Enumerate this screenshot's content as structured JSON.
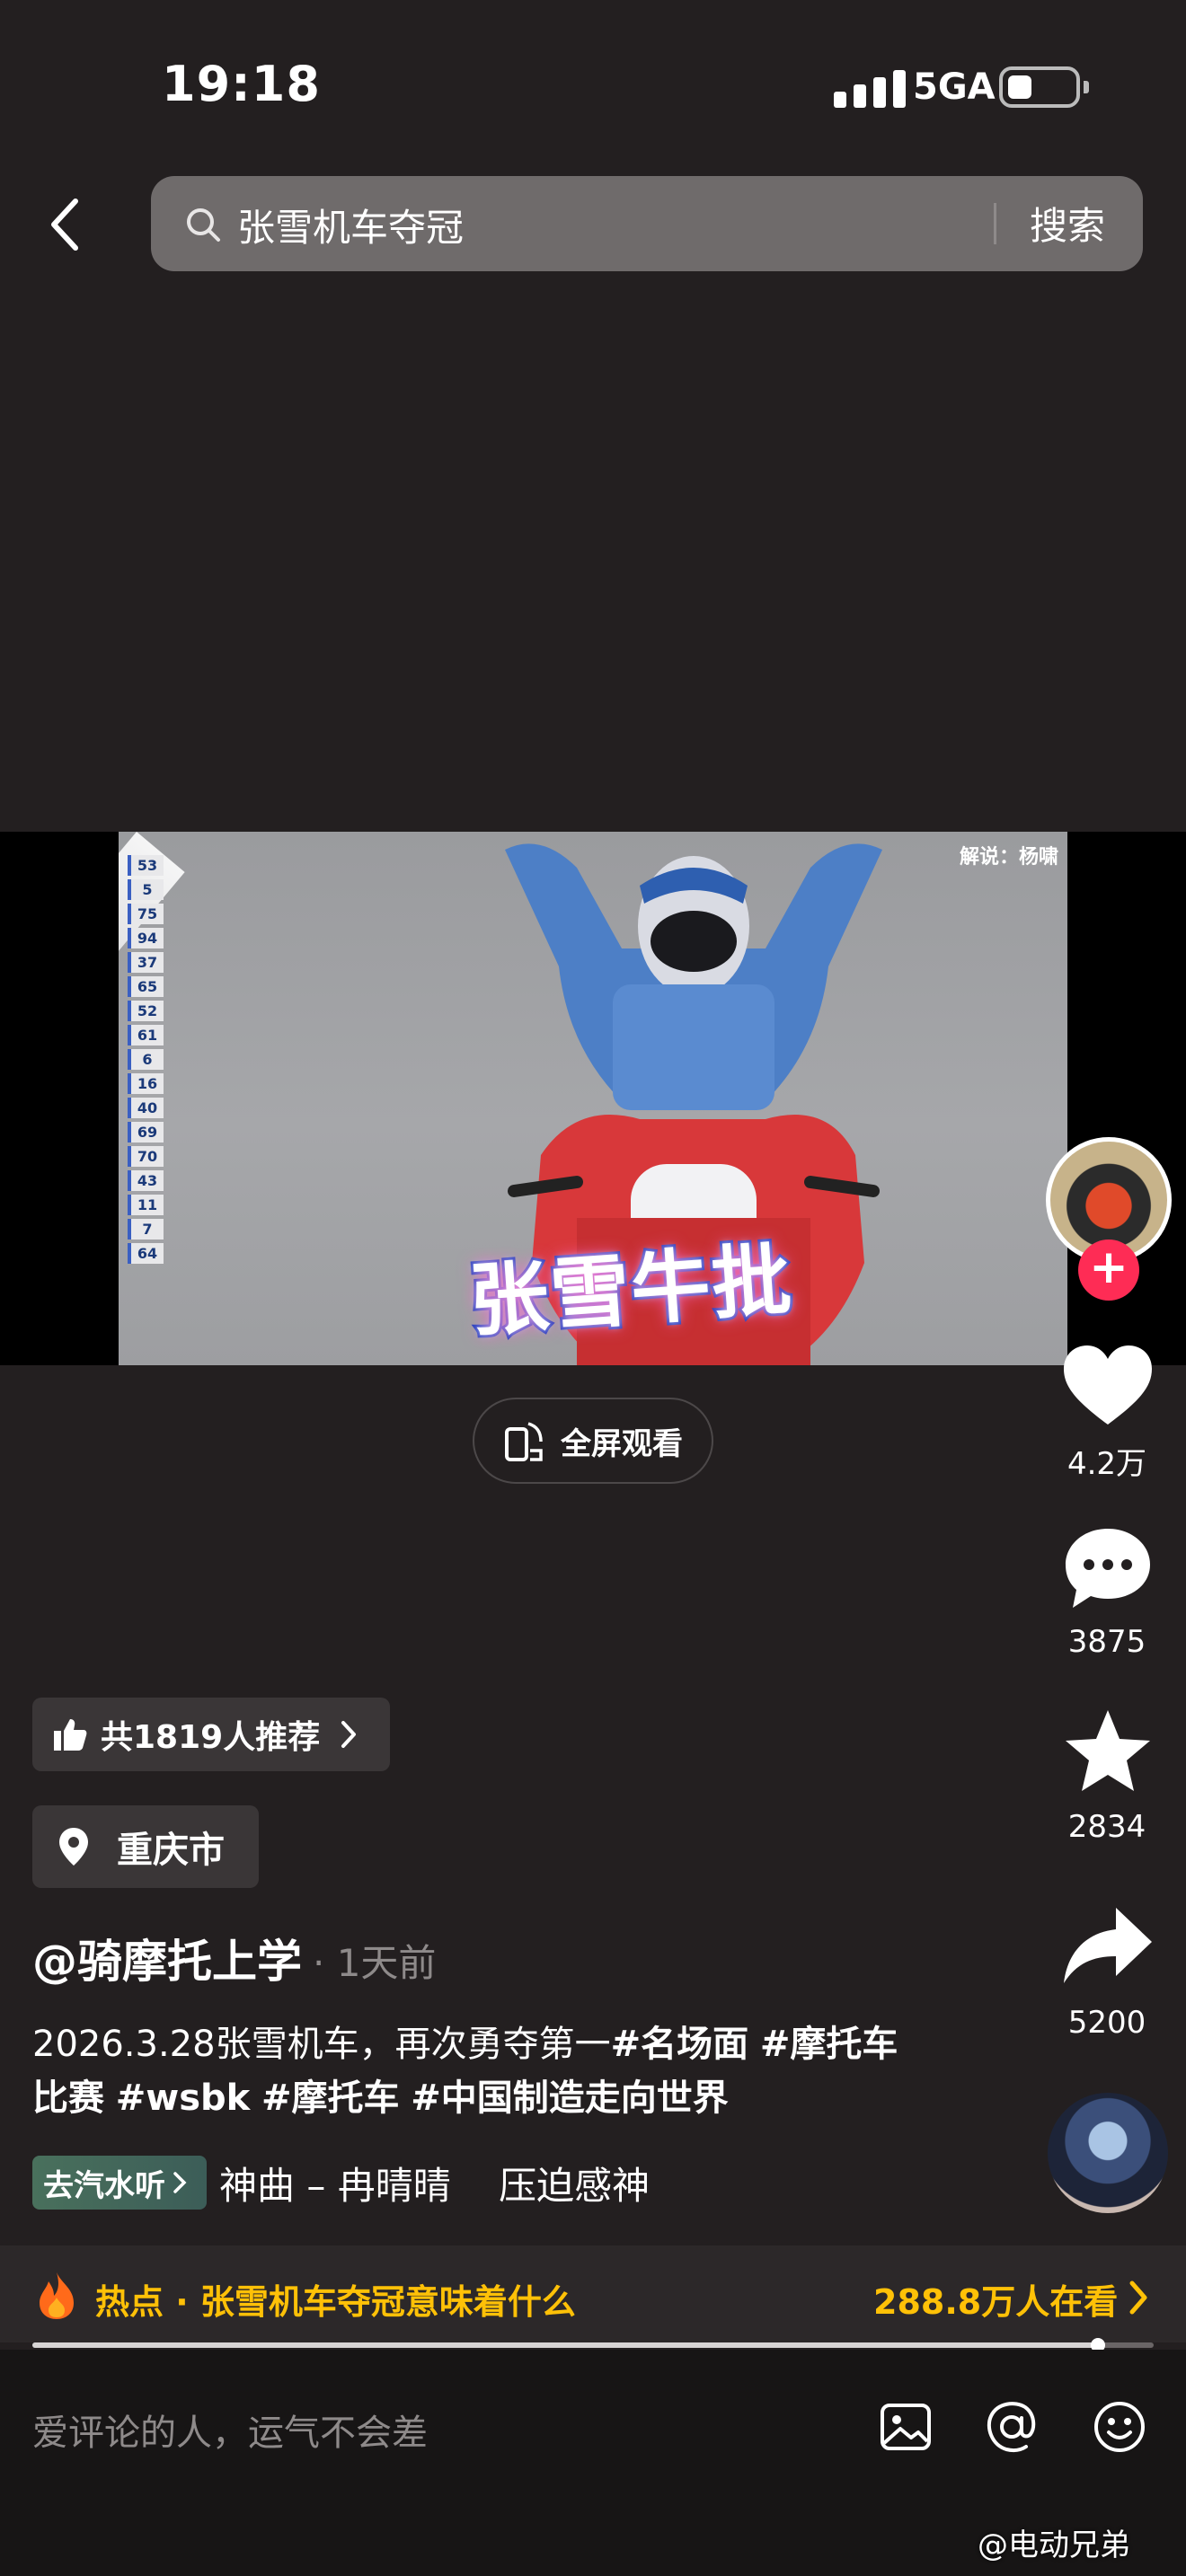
{
  "status_bar": {
    "time": "19:18",
    "network": "5GA",
    "icons": [
      "signal-icon",
      "battery-icon"
    ]
  },
  "header": {
    "back_icon": "chevron-left-icon",
    "search_icon": "search-icon",
    "search_query": "张雪机车夺冠",
    "search_button": "搜索"
  },
  "video": {
    "overlay_caption": "张雪牛批",
    "corner_caption": "解说：杨啸",
    "standings": [
      "53",
      "5",
      "75",
      "94",
      "37",
      "65",
      "52",
      "61",
      "6",
      "16",
      "40",
      "69",
      "70",
      "43",
      "11",
      "7",
      "64"
    ]
  },
  "fullscreen": {
    "icon": "rotate-screen-icon",
    "label": "全屏观看"
  },
  "right_rail": {
    "avatar": "creator-avatar",
    "follow_icon": "plus-icon",
    "like": {
      "icon": "heart-icon",
      "count": "4.2万"
    },
    "comment": {
      "icon": "comment-bubble-icon",
      "count": "3875"
    },
    "favorite": {
      "icon": "star-icon",
      "count": "2834"
    },
    "share": {
      "icon": "share-arrow-icon",
      "count": "5200"
    },
    "music_disc": "music-disc-icon"
  },
  "post": {
    "recommend": {
      "icon": "thumbs-up-icon",
      "label": "共1819人推荐",
      "chevron": "chevron-right-icon"
    },
    "location": {
      "icon": "location-pin-icon",
      "label": "重庆市"
    },
    "author": "@骑摩托上学",
    "time_ago": "· 1天前",
    "description_text": "2026.3.28张雪机车，再次勇夺第一",
    "hashtags": [
      "#名场面",
      "#摩托车比赛",
      "#wsbk",
      "#摩托车",
      "#中国制造走向世界"
    ],
    "music_tag": "去汽水听",
    "music_text": "神曲 – 冉晴晴    压迫感神"
  },
  "hot": {
    "icon": "fire-icon",
    "label": "热点 · 张雪机车夺冠意味着什么",
    "viewers": "288.8万人在看",
    "chevron": "chevron-right-icon"
  },
  "playback": {
    "progress_fraction": 0.95
  },
  "comment_bar": {
    "placeholder": "爱评论的人，运气不会差",
    "icons": [
      "image-icon",
      "at-icon",
      "emoji-icon"
    ]
  },
  "watermark": "@电动兄弟",
  "colors": {
    "background": "#231f20",
    "accent_red": "#fe2c55",
    "hot_yellow": "#ffc107"
  }
}
